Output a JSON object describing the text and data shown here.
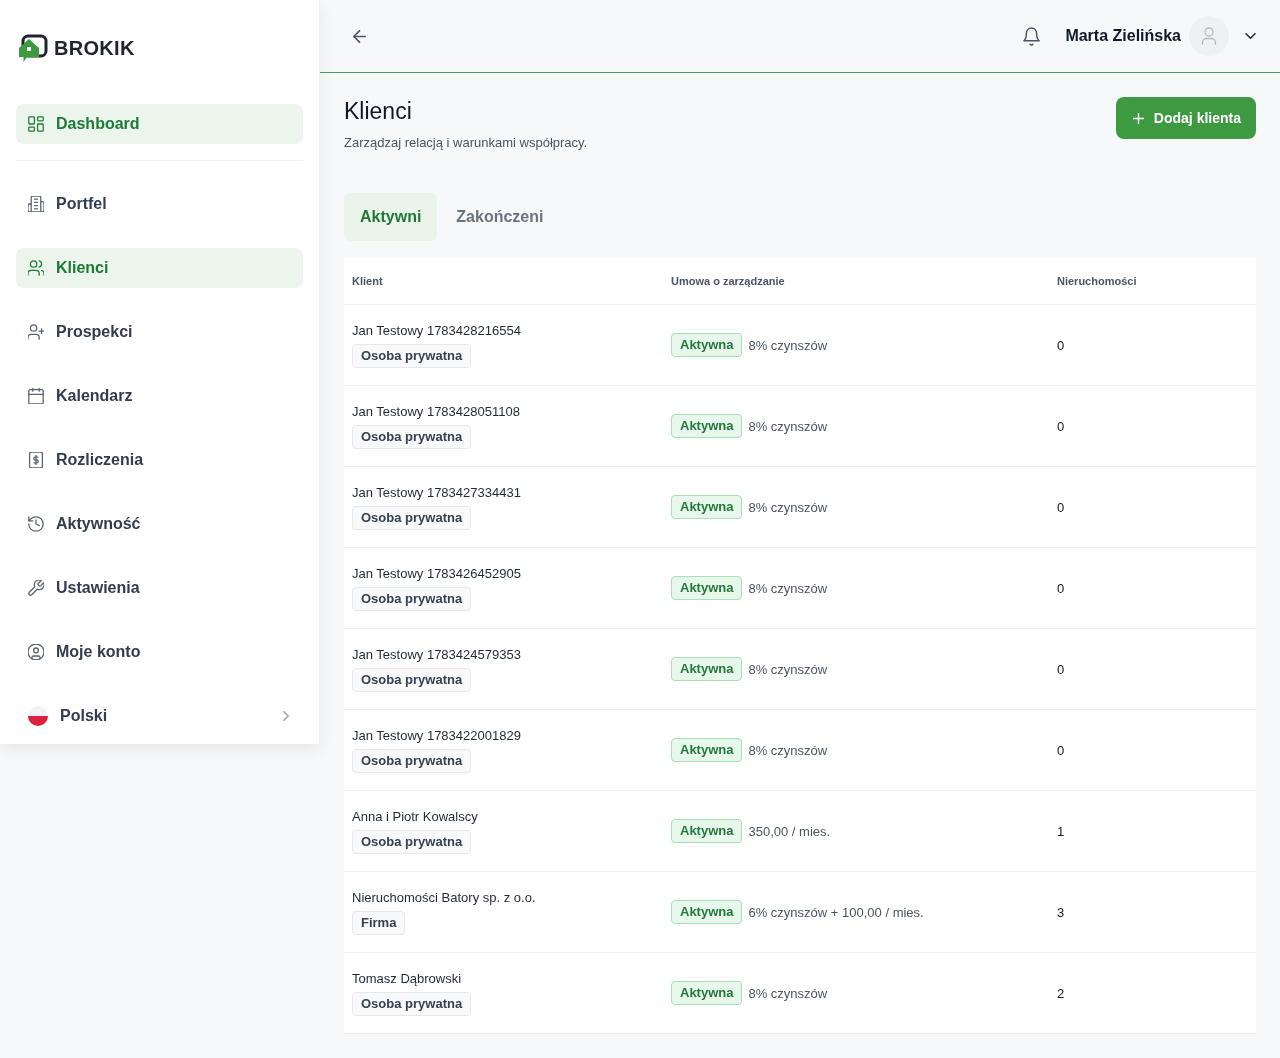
{
  "brand": {
    "name": "BROKIK"
  },
  "sidebar": {
    "pinned": {
      "label": "Dashboard",
      "selected": true
    },
    "items": [
      {
        "label": "Portfel",
        "selected": false
      },
      {
        "label": "Klienci",
        "selected": true
      },
      {
        "label": "Prospekci",
        "selected": false
      },
      {
        "label": "Kalendarz",
        "selected": false
      },
      {
        "label": "Rozliczenia",
        "selected": false
      },
      {
        "label": "Aktywność",
        "selected": false
      },
      {
        "label": "Ustawienia",
        "selected": false
      },
      {
        "label": "Moje konto",
        "selected": false
      }
    ],
    "language": {
      "label": "Polski"
    }
  },
  "header": {
    "user": {
      "name": "Marta Zielińska"
    }
  },
  "page": {
    "title": "Klienci",
    "subtitle": "Zarządzaj relacją i warunkami współpracy.",
    "add_button": {
      "label": "Dodaj klienta"
    }
  },
  "tabs": [
    {
      "label": "Aktywni",
      "selected": true
    },
    {
      "label": "Zakończeni",
      "selected": false
    }
  ],
  "table": {
    "columns": [
      "Klient",
      "Umowa o zarządzanie",
      "Nieruchomości"
    ],
    "rows": [
      {
        "name": "Jan Testowy 1783428216554",
        "type": "Osoba prywatna",
        "status": "Aktywna",
        "terms": "8% czynszów",
        "properties": "0"
      },
      {
        "name": "Jan Testowy 1783428051108",
        "type": "Osoba prywatna",
        "status": "Aktywna",
        "terms": "8% czynszów",
        "properties": "0"
      },
      {
        "name": "Jan Testowy 1783427334431",
        "type": "Osoba prywatna",
        "status": "Aktywna",
        "terms": "8% czynszów",
        "properties": "0"
      },
      {
        "name": "Jan Testowy 1783426452905",
        "type": "Osoba prywatna",
        "status": "Aktywna",
        "terms": "8% czynszów",
        "properties": "0"
      },
      {
        "name": "Jan Testowy 1783424579353",
        "type": "Osoba prywatna",
        "status": "Aktywna",
        "terms": "8% czynszów",
        "properties": "0"
      },
      {
        "name": "Jan Testowy 1783422001829",
        "type": "Osoba prywatna",
        "status": "Aktywna",
        "terms": "8% czynszów",
        "properties": "0"
      },
      {
        "name": "Anna i Piotr Kowalscy",
        "type": "Osoba prywatna",
        "status": "Aktywna",
        "terms": "350,00 / mies.",
        "properties": "1"
      },
      {
        "name": "Nieruchomości Batory sp. z o.o.",
        "type": "Firma",
        "status": "Aktywna",
        "terms": "6% czynszów + 100,00 / mies.",
        "properties": "3"
      },
      {
        "name": "Tomasz Dąbrowski",
        "type": "Osoba prywatna",
        "status": "Aktywna",
        "terms": "8% czynszów",
        "properties": "2"
      }
    ]
  }
}
